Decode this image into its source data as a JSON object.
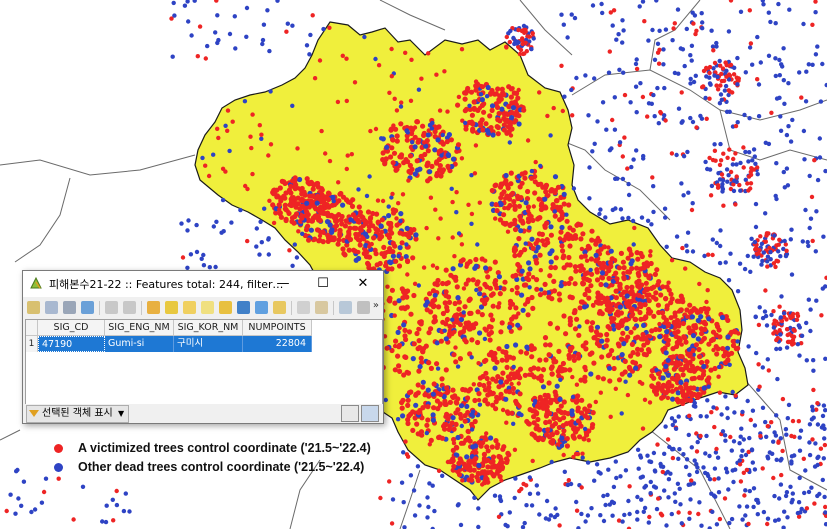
{
  "colors": {
    "region_fill": "#f0ef3c",
    "region_stroke": "#1a1a1a",
    "victimized_dot": "#ee2424",
    "other_dot": "#2e43c4",
    "boundary_line": "#6a6a6a",
    "selection": "#1e78d4"
  },
  "attribute_window": {
    "title": "피해본수21-22 :: Features total: 244, filtered: ...",
    "title_icon": "qgis-icon",
    "minimize_label": "—",
    "maximize_label": "☐",
    "close_label": "✕",
    "toolbar_icons": [
      "edit-pencil-icon",
      "multi-edit-icon",
      "save-icon",
      "reload-icon",
      "add-feature-icon",
      "delete-feature-icon",
      "select-all-icon",
      "select-expression-icon",
      "invert-selection-icon",
      "deselect-icon",
      "filter-icon",
      "move-selection-top-icon",
      "pan-to-selection-icon",
      "zoom-to-selection-icon",
      "copy-icon",
      "paste-icon",
      "new-field-icon",
      "delete-field-icon",
      "field-calculator-icon"
    ],
    "more_label": "»",
    "columns": [
      "SIG_CD",
      "SIG_ENG_NM",
      "SIG_KOR_NM",
      "NUMPOINTS"
    ],
    "rows": [
      {
        "row_number": "1",
        "cells": [
          "47190",
          "Gumi-si",
          "구미시",
          "22804"
        ]
      }
    ],
    "filter_button_label": "선택된 객체 표시",
    "filter_dropdown_icon": "chevron-down-icon",
    "view_buttons": [
      "form-view-icon",
      "table-view-icon"
    ]
  },
  "legend": {
    "items": [
      {
        "label": "A victimized trees control coordinate ('21.5~'22.4)",
        "color": "#ee2424"
      },
      {
        "label": "Other dead trees control coordinate ('21.5~'22.4)",
        "color": "#2e43c4"
      }
    ]
  }
}
